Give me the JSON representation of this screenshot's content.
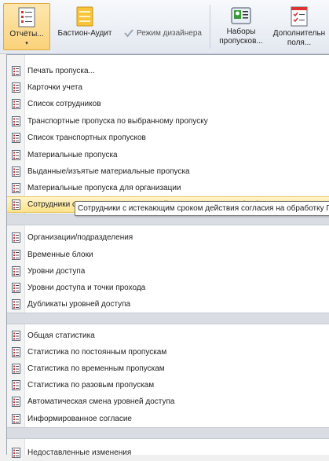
{
  "ribbon": {
    "reports_label": "Отчёты...",
    "bastion_label": "Бастион-Аудит",
    "designer_label": "Режим дизайнера",
    "passsets_label_1": "Наборы",
    "passsets_label_2": "пропусков...",
    "extra_label_1": "Дополнительн",
    "extra_label_2": "поля...",
    "accent": "#fbd27a"
  },
  "menu": {
    "items": [
      "Печать пропуска...",
      "Карточки учета",
      "Список сотрудников",
      "Транспортные пропуска по выбранному пропуску",
      "Список транспортных пропусков",
      "Материальные пропуска",
      "Выданные/изъятые материальные пропуска",
      "Материальные пропуска для организации",
      "Сотрудники с истекающим сроком действия согласия на обработку ПД",
      "Организации/подразделения",
      "Временные блоки",
      "Уровни доступа",
      "Уровни доступа и точки прохода",
      "Дубликаты уровней доступа",
      "Общая статистика",
      "Статистика по постоянным пропускам",
      "Статистика по временным пропускам",
      "Статистика по разовым пропускам",
      "Автоматическая смена уровней доступа",
      "Информированное согласие",
      "Недоставленные изменения"
    ],
    "tooltip": "Сотрудники с истекающим сроком действия согласия на обработку ПД"
  }
}
